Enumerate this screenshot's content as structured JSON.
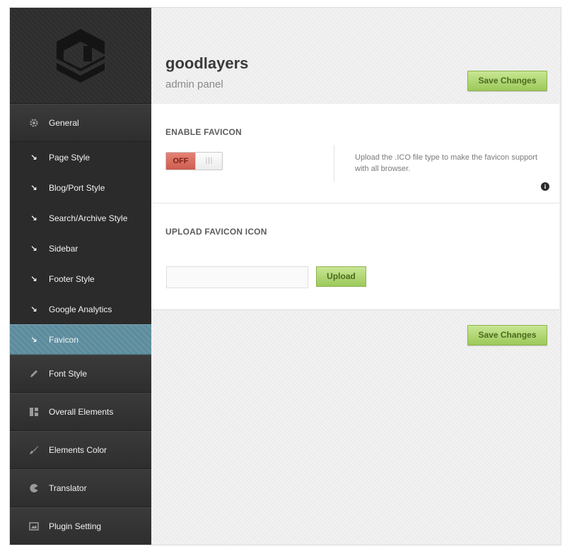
{
  "brand": {
    "name": "goodlayers",
    "subtitle": "admin panel"
  },
  "sidebar": {
    "logo": "goodlayers-logo",
    "items": [
      {
        "label": "General",
        "icon": "gear-icon"
      },
      {
        "label": "Font Style",
        "icon": "pencil-icon"
      },
      {
        "label": "Overall Elements",
        "icon": "layout-icon"
      },
      {
        "label": "Elements Color",
        "icon": "brush-icon"
      },
      {
        "label": "Translator",
        "icon": "pacman-icon"
      },
      {
        "label": "Plugin Setting",
        "icon": "image-icon"
      }
    ],
    "general_sub": [
      {
        "label": "Page Style"
      },
      {
        "label": "Blog/Port Style"
      },
      {
        "label": "Search/Archive Style"
      },
      {
        "label": "Sidebar"
      },
      {
        "label": "Footer Style"
      },
      {
        "label": "Google Analytics"
      },
      {
        "label": "Favicon",
        "active": true
      }
    ],
    "sub_arrow": "↘"
  },
  "header": {
    "save_label": "Save Changes"
  },
  "favicon": {
    "title": "ENABLE FAVICON",
    "toggle_off_label": "OFF",
    "toggle_knob": "|||",
    "description": "Upload the .ICO file type to make the favicon support with all browser.",
    "info_icon": "i"
  },
  "upload": {
    "title": "UPLOAD FAVICON ICON",
    "input_value": "",
    "button_label": "Upload"
  },
  "footer": {
    "save_label": "Save Changes"
  },
  "colors": {
    "accent_green": "#9cc95a",
    "active_blue": "#5c8aa1",
    "toggle_red": "#cf5c4e"
  }
}
